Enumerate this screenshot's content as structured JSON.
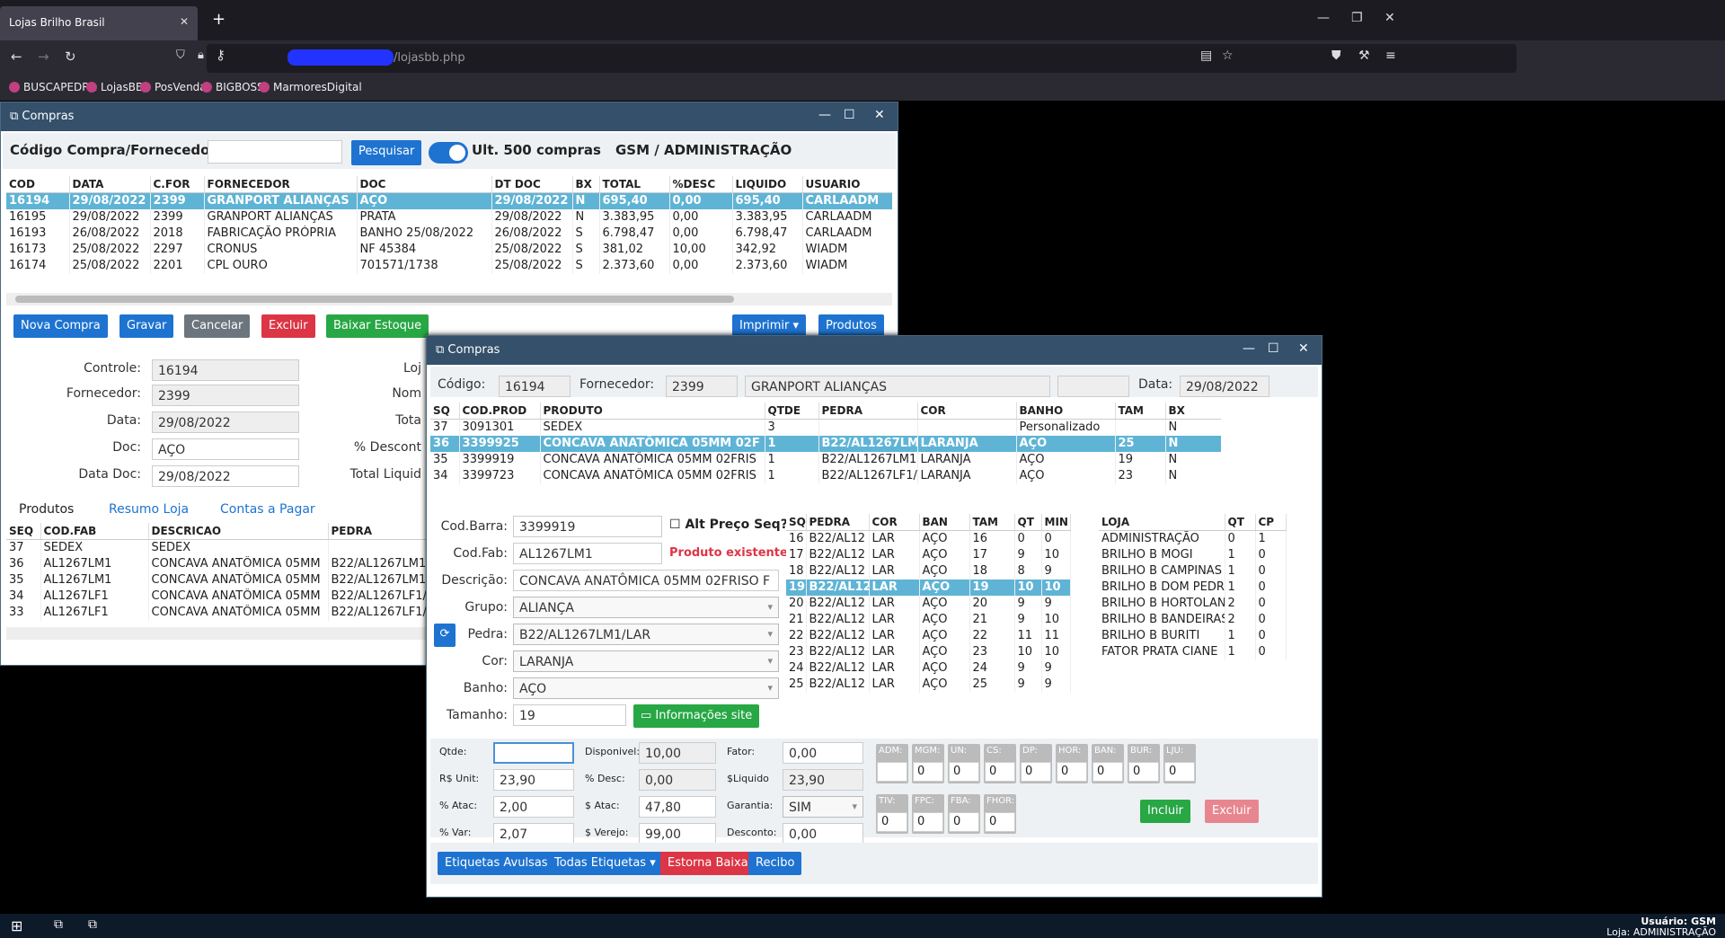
{
  "browser": {
    "tab_title": "Lojas Brilho Brasil",
    "url": "/lojasbb.php",
    "bookmarks": [
      "BUSCAPEDRA",
      "LojasBB",
      "PosVenda",
      "BIGBOSS",
      "MarmoresDigital"
    ]
  },
  "w1": {
    "title": "Compras",
    "search_label": "Código Compra/Fornecedor",
    "search_button": "Pesquisar",
    "toggle_label": "Ult. 500 compras",
    "user_info": "GSM / ADMINISTRAÇÃO",
    "columns": [
      "COD",
      "DATA",
      "C.FOR",
      "FORNECEDOR",
      "DOC",
      "DT DOC",
      "BX",
      "TOTAL",
      "%DESC",
      "LIQUIDO",
      "USUARIO"
    ],
    "rows": [
      [
        "16194",
        "29/08/2022",
        "2399",
        "GRANPORT ALIANÇAS",
        "AÇO",
        "29/08/2022",
        "N",
        "695,40",
        "0,00",
        "695,40",
        "CARLAADM"
      ],
      [
        "16195",
        "29/08/2022",
        "2399",
        "GRANPORT ALIANÇAS",
        "PRATA",
        "29/08/2022",
        "N",
        "3.383,95",
        "0,00",
        "3.383,95",
        "CARLAADM"
      ],
      [
        "16193",
        "26/08/2022",
        "2018",
        "FABRICAÇÃO PRÓPRIA",
        "BANHO 25/08/2022",
        "26/08/2022",
        "S",
        "6.798,47",
        "0,00",
        "6.798,47",
        "CARLAADM"
      ],
      [
        "16173",
        "25/08/2022",
        "2297",
        "CRONUS",
        "NF 45384",
        "25/08/2022",
        "S",
        "381,02",
        "10,00",
        "342,92",
        "WIADM"
      ],
      [
        "16174",
        "25/08/2022",
        "2201",
        "CPL OURO",
        "701571/1738",
        "25/08/2022",
        "S",
        "2.373,60",
        "0,00",
        "2.373,60",
        "WIADM"
      ]
    ],
    "buttons": {
      "nova": "Nova Compra",
      "gravar": "Gravar",
      "cancelar": "Cancelar",
      "excluir": "Excluir",
      "baixar": "Baixar Estoque",
      "imprimir": "Imprimir",
      "produtos": "Produtos"
    },
    "form": {
      "controle_label": "Controle:",
      "controle": "16194",
      "fornecedor_label": "Fornecedor:",
      "fornecedor": "2399",
      "data_label": "Data:",
      "data": "29/08/2022",
      "doc_label": "Doc:",
      "doc": "AÇO",
      "datadoc_label": "Data Doc:",
      "datadoc": "29/08/2022",
      "loja_label": "Loj",
      "nome_label": "Nom",
      "total_label": "Tota",
      "desc_label": "% Descont",
      "liq_label": "Total Liquid"
    },
    "tabs": [
      "Produtos",
      "Resumo Loja",
      "Contas a Pagar"
    ],
    "pcolumns": [
      "SEQ",
      "COD.FAB",
      "DESCRICAO",
      "PEDRA"
    ],
    "prows": [
      [
        "37",
        "SEDEX",
        "SEDEX",
        ""
      ],
      [
        "36",
        "AL1267LM1",
        "CONCAVA ANATÔMICA 05MM",
        "B22/AL1267LM1"
      ],
      [
        "35",
        "AL1267LM1",
        "CONCAVA ANATÔMICA 05MM",
        "B22/AL1267LM1"
      ],
      [
        "34",
        "AL1267LF1",
        "CONCAVA ANATÔMICA 05MM",
        "B22/AL1267LF1/"
      ],
      [
        "33",
        "AL1267LF1",
        "CONCAVA ANATÔMICA 05MM",
        "B22/AL1267LF1/"
      ]
    ]
  },
  "w2": {
    "title": "Compras",
    "codigo_label": "Código:",
    "codigo": "16194",
    "fornecedor_label": "Fornecedor:",
    "fornecedor": "2399",
    "fornecedor_nome": "GRANPORT ALIANÇAS",
    "data_label": "Data:",
    "data": "29/08/2022",
    "columns": [
      "SQ",
      "COD.PROD",
      "PRODUTO",
      "QTDE",
      "PEDRA",
      "COR",
      "BANHO",
      "TAM",
      "BX"
    ],
    "rows": [
      [
        "37",
        "3091301",
        "SEDEX",
        "3",
        "",
        "",
        "Personalizado",
        "",
        "N"
      ],
      [
        "36",
        "3399925",
        "CONCAVA ANATÔMICA 05MM 02F",
        "1",
        "B22/AL1267LM",
        "LARANJA",
        "AÇO",
        "25",
        "N"
      ],
      [
        "35",
        "3399919",
        "CONCAVA ANATÔMICA 05MM 02FRIS",
        "1",
        "B22/AL1267LM1",
        "LARANJA",
        "AÇO",
        "19",
        "N"
      ],
      [
        "34",
        "3399723",
        "CONCAVA ANATÔMICA 05MM 02FRIS",
        "1",
        "B22/AL1267LF1/",
        "LARANJA",
        "AÇO",
        "23",
        "N"
      ]
    ],
    "codbarra_label": "Cod.Barra:",
    "codbarra": "3399919",
    "alt_preco": "Alt Preço Seq?",
    "codfab_label": "Cod.Fab:",
    "codfab": "AL1267LM1",
    "existente": "Produto existente.",
    "descricao_label": "Descrição:",
    "descricao": "CONCAVA ANATÔMICA 05MM 02FRISO F",
    "grupo_label": "Grupo:",
    "grupo": "ALIANÇA",
    "pedra_label": "Pedra:",
    "pedra": "B22/AL1267LM1/LAR",
    "cor_label": "Cor:",
    "cor": "LARANJA",
    "banho_label": "Banho:",
    "banho": "AÇO",
    "tamanho_label": "Tamanho:",
    "tamanho": "19",
    "info_site": "Informações site",
    "scolumns": [
      "SQ",
      "PEDRA",
      "COR",
      "BAN",
      "TAM",
      "QT",
      "MIN"
    ],
    "srows": [
      [
        "16",
        "B22/AL12",
        "LAR",
        "AÇO",
        "16",
        "0",
        "0"
      ],
      [
        "17",
        "B22/AL12",
        "LAR",
        "AÇO",
        "17",
        "9",
        "10"
      ],
      [
        "18",
        "B22/AL12",
        "LAR",
        "AÇO",
        "18",
        "8",
        "9"
      ],
      [
        "19",
        "B22/AL12",
        "LAR",
        "AÇO",
        "19",
        "10",
        "10"
      ],
      [
        "20",
        "B22/AL12",
        "LAR",
        "AÇO",
        "20",
        "9",
        "9"
      ],
      [
        "21",
        "B22/AL12",
        "LAR",
        "AÇO",
        "21",
        "9",
        "10"
      ],
      [
        "22",
        "B22/AL12",
        "LAR",
        "AÇO",
        "22",
        "11",
        "11"
      ],
      [
        "23",
        "B22/AL12",
        "LAR",
        "AÇO",
        "23",
        "10",
        "10"
      ],
      [
        "24",
        "B22/AL12",
        "LAR",
        "AÇO",
        "24",
        "9",
        "9"
      ],
      [
        "25",
        "B22/AL12",
        "LAR",
        "AÇO",
        "25",
        "9",
        "9"
      ]
    ],
    "lcolumns": [
      "LOJA",
      "QT",
      "CP"
    ],
    "lrows": [
      [
        "ADMINISTRAÇÃO",
        "0",
        "1"
      ],
      [
        "BRILHO B MOGI",
        "1",
        "0"
      ],
      [
        "BRILHO B CAMPINAS",
        "1",
        "0"
      ],
      [
        "BRILHO B DOM PEDRO",
        "1",
        "0"
      ],
      [
        "BRILHO B HORTOLANDIA",
        "2",
        "0"
      ],
      [
        "BRILHO B BANDEIRAS",
        "2",
        "0"
      ],
      [
        "BRILHO B BURITI",
        "1",
        "0"
      ],
      [
        "FATOR PRATA CIANE",
        "1",
        "0"
      ]
    ],
    "qtde_label": "Qtde:",
    "qtde": "",
    "disp_label": "Disponivel:",
    "disp": "10,00",
    "fator_label": "Fator:",
    "fator": "0,00",
    "unit_label": "R$ Unit:",
    "unit": "23,90",
    "pdesc_label": "% Desc:",
    "pdesc": "0,00",
    "liq_label": "$Liquido",
    "liq": "23,90",
    "atac_label": "% Atac:",
    "atac": "2,00",
    "satac_label": "$ Atac:",
    "satac": "47,80",
    "garantia_label": "Garantia:",
    "garantia": "SIM",
    "var_label": "% Var:",
    "var": "2,07",
    "verejo_label": "$ Verejo:",
    "verejo": "99,00",
    "desconto_label": "Desconto:",
    "desconto": "0,00",
    "lojas1": [
      [
        "ADM:",
        ""
      ],
      [
        "MGM:",
        "0"
      ],
      [
        "UN:",
        "0"
      ],
      [
        "CS:",
        "0"
      ],
      [
        "DP:",
        "0"
      ],
      [
        "HOR:",
        "0"
      ],
      [
        "BAN:",
        "0"
      ],
      [
        "BUR:",
        "0"
      ],
      [
        "LJU:",
        "0"
      ]
    ],
    "lojas2": [
      [
        "TIV:",
        "0"
      ],
      [
        "FPC:",
        "0"
      ],
      [
        "FBA:",
        "0"
      ],
      [
        "FHOR:",
        "0"
      ]
    ],
    "incluir": "Incluir",
    "excluir": "Excluir",
    "avulsas": "Etiquetas Avulsas",
    "todas": "Todas Etiquetas",
    "estorna": "Estorna Baixa",
    "recibo": "Recibo"
  },
  "taskbar": {
    "usuario": "Usuário: GSM",
    "loja": "Loja: ADMINISTRAÇÃO"
  }
}
